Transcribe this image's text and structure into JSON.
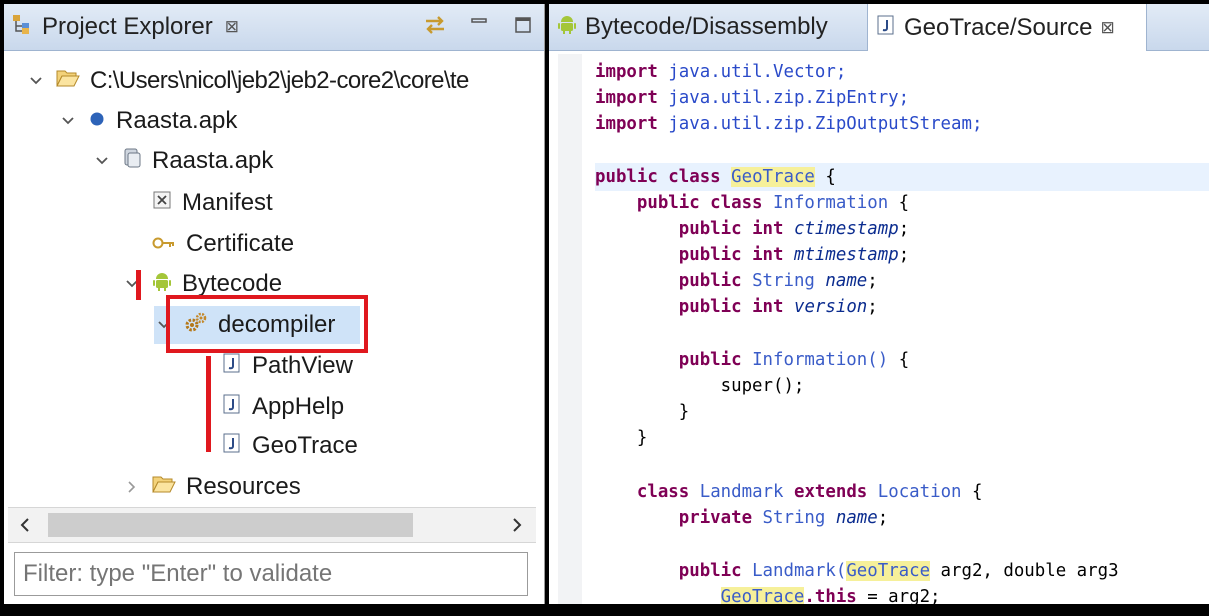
{
  "colors": {
    "highlight_red": "#e0181e",
    "keyword": "#7f0055",
    "type": "#3a5cc8",
    "selection": "#cfe3f8"
  },
  "left_panel": {
    "tab_icon": "package-explorer-icon",
    "tab_title": "Project Explorer",
    "tab_close": "⊠",
    "tools": [
      "link-with-editor-icon",
      "minimize-icon",
      "maximize-icon"
    ],
    "tree": [
      {
        "label": "C:\\Users\\nicol\\jeb2\\jeb2-core2\\core\\te",
        "icon": "folder-open-icon",
        "expanded": true
      },
      {
        "label": "Raasta.apk",
        "icon": "artifact-dot-icon",
        "expanded": true
      },
      {
        "label": "Raasta.apk",
        "icon": "apk-unit-icon",
        "expanded": true
      },
      {
        "label": "Manifest",
        "icon": "xml-icon"
      },
      {
        "label": "Certificate",
        "icon": "key-icon"
      },
      {
        "label": "Bytecode",
        "icon": "android-icon",
        "expanded": true
      },
      {
        "label": "decompiler",
        "icon": "gears-icon",
        "expanded": true,
        "selected": true
      },
      {
        "label": "PathView",
        "icon": "java-file-icon"
      },
      {
        "label": "AppHelp",
        "icon": "java-file-icon"
      },
      {
        "label": "GeoTrace",
        "icon": "java-file-icon"
      },
      {
        "label": "Resources",
        "icon": "folder-open-icon",
        "expanded": false
      }
    ],
    "filter_placeholder": "Filter: type \"Enter\" to validate"
  },
  "editor": {
    "tabs": [
      {
        "label": "Bytecode/Disassembly",
        "icon": "android-icon",
        "active": false
      },
      {
        "label": "GeoTrace/Source",
        "icon": "java-file-icon",
        "active": true,
        "close": "⊠"
      }
    ],
    "code": {
      "imports": [
        {
          "kw": "import",
          "pkg": "java.util.Vector;"
        },
        {
          "kw": "import",
          "pkg": "java.util.zip.ZipEntry;"
        },
        {
          "kw": "import",
          "pkg": "java.util.zip.ZipOutputStream;"
        }
      ],
      "class_decl": {
        "kw": "public class",
        "name": "GeoTrace",
        "brace": "{"
      },
      "inner_decl": {
        "kw": "public class",
        "name": "Information",
        "brace": "{"
      },
      "fields": [
        {
          "kw": "public",
          "type": "int",
          "name": "ctimestamp"
        },
        {
          "kw": "public",
          "type": "int",
          "name": "mtimestamp"
        },
        {
          "kw": "public",
          "type": "String",
          "name": "name"
        },
        {
          "kw": "public",
          "type": "int",
          "name": "version"
        }
      ],
      "ctor": {
        "kw": "public",
        "name": "Information()",
        "brace": "{"
      },
      "super_call": "super();",
      "close1": "}",
      "close2": "}",
      "landmark_decl": {
        "kw1": "class",
        "name": "Landmark",
        "kw2": "extends",
        "parent": "Location",
        "brace": "{"
      },
      "landmark_field": {
        "kw": "private",
        "type": "String",
        "name": "name"
      },
      "landmark_ctor": {
        "kw": "public",
        "name": "Landmark(",
        "ptype": "GeoTrace",
        "rest": " arg2, double arg3"
      },
      "assign": {
        "target": "GeoTrace",
        "kw": ".this",
        "rest": " = arg2;"
      }
    }
  }
}
